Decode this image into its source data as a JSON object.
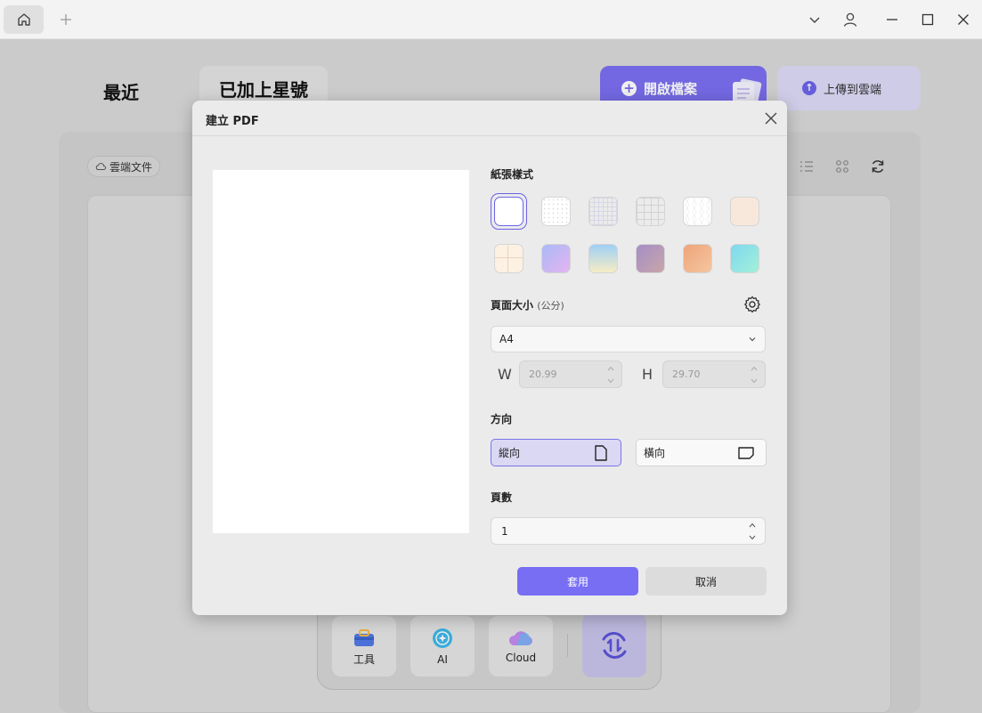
{
  "window": {
    "icons": [
      "home-icon",
      "plus-icon",
      "chevron-down-icon",
      "user-icon",
      "minimize-icon",
      "maximize-icon",
      "close-icon"
    ]
  },
  "page": {
    "tab_recent": "最近",
    "tab_starred": "已加上星號",
    "open_file": "開啟檔案",
    "upload_cloud": "上傳到雲端",
    "cloud_docs": "雲端文件"
  },
  "dock": {
    "tools": "工具",
    "ai": "AI",
    "cloud": "Cloud"
  },
  "dialog": {
    "title": "建立 PDF",
    "paper_style_label": "紙張樣式",
    "paper_styles": [
      {
        "name": "blank-white",
        "color": "#ffffff",
        "selected": true
      },
      {
        "name": "dot-grid",
        "color": "#ffffff"
      },
      {
        "name": "fine-grid",
        "color": "#ffffff"
      },
      {
        "name": "square-grid",
        "color": "#ffffff"
      },
      {
        "name": "isometric",
        "color": "#ffffff"
      },
      {
        "name": "peach",
        "color": "#f8e8dc"
      },
      {
        "name": "cream-sections",
        "color": "#fdf1e3"
      },
      {
        "name": "lavender-gradient",
        "color": "#c9b2f4"
      },
      {
        "name": "sky-gradient",
        "color": "#bde0f8"
      },
      {
        "name": "mauve-gradient",
        "color": "#b59fbf"
      },
      {
        "name": "orange-gradient",
        "color": "#f1b48c"
      },
      {
        "name": "aqua-gradient",
        "color": "#8fe3ea"
      }
    ],
    "page_size_label": "頁面大小",
    "page_size_unit": "(公分)",
    "page_size_value": "A4",
    "width_letter": "W",
    "width_value": "20.99",
    "height_letter": "H",
    "height_value": "29.70",
    "orientation_label": "方向",
    "portrait": "縱向",
    "landscape": "橫向",
    "orientation_selected": "portrait",
    "pages_label": "頁數",
    "pages_value": "1",
    "apply": "套用",
    "cancel": "取消",
    "accent": "#776ef4"
  }
}
